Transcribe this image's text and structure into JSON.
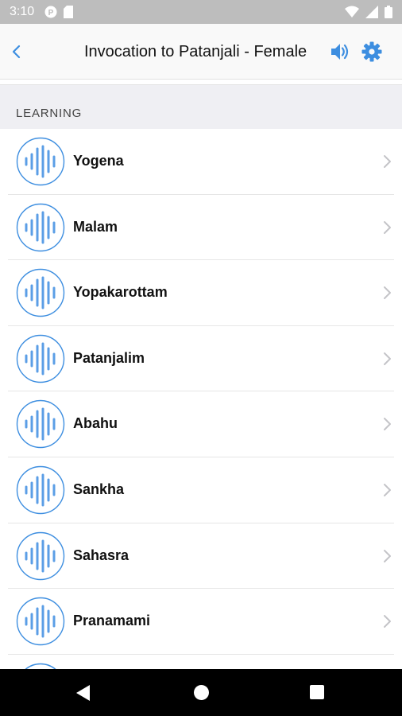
{
  "status_bar": {
    "time": "3:10",
    "left_icons": [
      "p-circle-icon",
      "sd-card-icon"
    ],
    "right_icons": [
      "wifi-icon",
      "signal-icon",
      "battery-icon"
    ]
  },
  "header": {
    "title": "Invocation to Patanjali - Female",
    "back_icon": "chevron-left-icon",
    "speaker_icon": "speaker-icon",
    "settings_icon": "gear-icon",
    "accent_color": "#3d8ee0"
  },
  "section": {
    "label": "LEARNING"
  },
  "list": {
    "items": [
      {
        "label": "Yogena"
      },
      {
        "label": "Malam"
      },
      {
        "label": "Yopakarottam"
      },
      {
        "label": "Patanjalim"
      },
      {
        "label": "Abahu"
      },
      {
        "label": "Sankha"
      },
      {
        "label": "Sahasra"
      },
      {
        "label": "Pranamami"
      },
      {
        "label": ""
      }
    ],
    "item_icon": "audio-waveform-icon",
    "chevron_icon": "chevron-right-icon"
  },
  "nav_bar": {
    "icons": [
      "nav-back-icon",
      "nav-home-icon",
      "nav-recents-icon"
    ]
  }
}
